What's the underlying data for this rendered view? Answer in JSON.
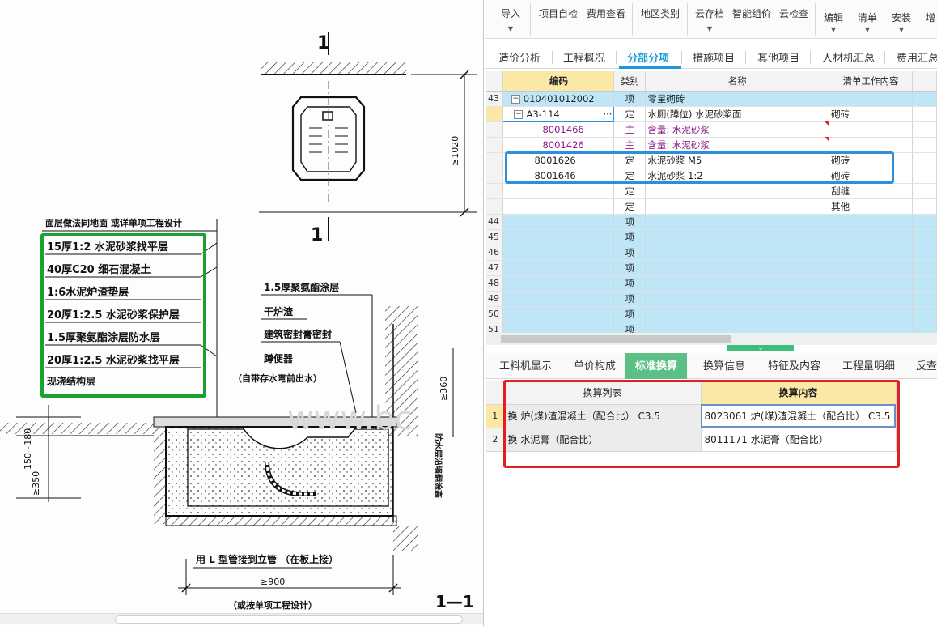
{
  "drawing": {
    "section_mark_top": "1",
    "section_mark_bottom": "1",
    "dim_height_1020": "≥1020",
    "layers_title": "面层做法同地面 或详单项工程设计",
    "layers": [
      "15厚1:2 水泥砂浆找平层",
      "40厚C20 细石混凝土",
      "1:6水泥炉渣垫层",
      "20厚1:2.5 水泥砂浆保护层",
      "1.5厚聚氨酯涂层防水层",
      "20厚1:2.5 水泥砂浆找平层",
      "现浇结构层"
    ],
    "callouts": [
      "1.5厚聚氨酯涂层",
      "干炉渣",
      "建筑密封膏密封",
      "蹲便器",
      "（自带存水弯前出水）"
    ],
    "wall_note": "防水层沿墙翻涂高",
    "dim_150_180": "150~180",
    "dim_350": "≥350",
    "dim_360": "≥360",
    "pipe_note": "用 L 型管接到立管 （在板上接）",
    "dim_900": "≥900",
    "bottom_note": "（或按单项工程设计）",
    "section_label": "1—1",
    "watermark": "www.bc"
  },
  "toolbar": {
    "buttons": [
      "导入",
      "项目自检",
      "费用查看",
      "地区类别",
      "云存档",
      "智能组价",
      "云检查",
      "编辑",
      "清单",
      "安装",
      "增"
    ]
  },
  "main_tabs": [
    "造价分析",
    "工程概况",
    "分部分项",
    "措施项目",
    "其他项目",
    "人材机汇总",
    "费用汇总"
  ],
  "grid": {
    "headers": [
      "编码",
      "类别",
      "名称",
      "清单工作内容"
    ],
    "rows": [
      {
        "rn": "43",
        "code": "010401012002",
        "type": "项",
        "name": "零星砌砖",
        "work": ""
      },
      {
        "rn": "",
        "code": "A3-114",
        "more": "···",
        "type": "定",
        "name": "水厕(蹲位) 水泥砂浆面",
        "work": "砌砖"
      },
      {
        "rn": "",
        "code": "8001466",
        "type": "主",
        "name": "含量: 水泥砂浆",
        "work": ""
      },
      {
        "rn": "",
        "code": "8001426",
        "type": "主",
        "name": "含量: 水泥砂浆",
        "work": ""
      },
      {
        "rn": "",
        "code": "8001626",
        "type": "定",
        "name": "水泥砂浆 M5",
        "work": "砌砖"
      },
      {
        "rn": "",
        "code": "8001646",
        "type": "定",
        "name": "水泥砂浆 1:2",
        "work": "砌砖"
      },
      {
        "rn": "",
        "code": "",
        "type": "定",
        "name": "",
        "work": "刮缝"
      },
      {
        "rn": "",
        "code": "",
        "type": "定",
        "name": "",
        "work": "其他"
      },
      {
        "rn": "44",
        "code": "",
        "type": "项",
        "name": "",
        "work": ""
      },
      {
        "rn": "45",
        "code": "",
        "type": "项",
        "name": "",
        "work": ""
      },
      {
        "rn": "46",
        "code": "",
        "type": "项",
        "name": "",
        "work": ""
      },
      {
        "rn": "47",
        "code": "",
        "type": "项",
        "name": "",
        "work": ""
      },
      {
        "rn": "48",
        "code": "",
        "type": "项",
        "name": "",
        "work": ""
      },
      {
        "rn": "49",
        "code": "",
        "type": "项",
        "name": "",
        "work": ""
      },
      {
        "rn": "50",
        "code": "",
        "type": "项",
        "name": "",
        "work": ""
      },
      {
        "rn": "51",
        "code": "",
        "type": "项",
        "name": "",
        "work": ""
      }
    ]
  },
  "sub_tabs": [
    "工料机显示",
    "单价构成",
    "标准换算",
    "换算信息",
    "特征及内容",
    "工程量明细",
    "反查"
  ],
  "conversion": {
    "headers": [
      "换算列表",
      "换算内容"
    ],
    "rows": [
      {
        "rn": "1",
        "list": "换 炉(煤)渣混凝土（配合比） C3.5",
        "content": "8023061  炉(煤)渣混凝土（配合比） C3.5"
      },
      {
        "rn": "2",
        "list": "换 水泥膏（配合比）",
        "content": "8011171  水泥膏（配合比）"
      }
    ]
  },
  "colors": {
    "accent": "#1a9bd8",
    "active_subtab": "#5bbf86",
    "highlight_header": "#fbe7a6",
    "row_blue": "#bfe6f6",
    "annot_green": "#1aa22e",
    "annot_blue": "#2b8fe0",
    "annot_red": "#e02020"
  }
}
